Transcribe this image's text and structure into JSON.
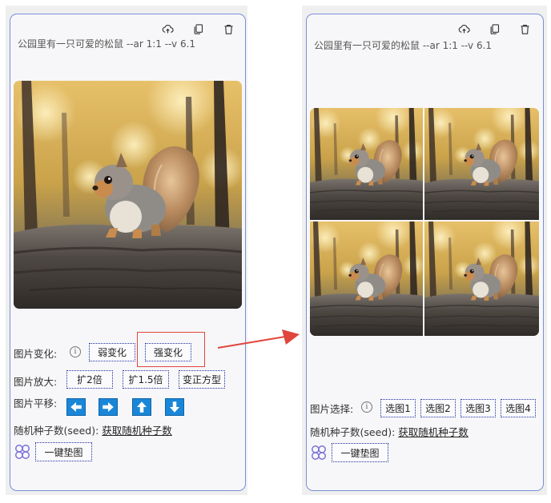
{
  "left_panel": {
    "prompt": "公园里有一只可爱的松鼠 --ar 1:1 --v 6.1",
    "toolbar_icons": [
      "cloud-upload-icon",
      "copy-icon",
      "trash-icon"
    ],
    "variation": {
      "label": "图片变化:",
      "weak": "弱变化",
      "strong": "强变化"
    },
    "zoom": {
      "label": "图片放大:",
      "x2": "扩2倍",
      "x15": "扩1.5倍",
      "square": "变正方型"
    },
    "pan": {
      "label": "图片平移:",
      "icons": [
        "arrow-left-icon",
        "arrow-right-icon",
        "arrow-up-icon",
        "arrow-down-icon"
      ]
    },
    "seed": {
      "label": "随机种子数(seed):",
      "link": "获取随机种子数"
    },
    "pad": {
      "label": "一键垫图"
    }
  },
  "right_panel": {
    "prompt": "公园里有一只可爱的松鼠 --ar 1:1 --v 6.1",
    "toolbar_icons": [
      "cloud-upload-icon",
      "copy-icon",
      "trash-icon"
    ],
    "select": {
      "label": "图片选择:",
      "options": [
        "选图1",
        "选图2",
        "选图3",
        "选图4"
      ]
    },
    "seed": {
      "label": "随机种子数(seed):",
      "link": "获取随机种子数"
    },
    "pad": {
      "label": "一键垫图"
    }
  },
  "colors": {
    "card_border": "#7b8fd6",
    "button_border": "#1c2c9c",
    "arrow_blue": "#1a86d8",
    "highlight_red": "#e0463b"
  }
}
